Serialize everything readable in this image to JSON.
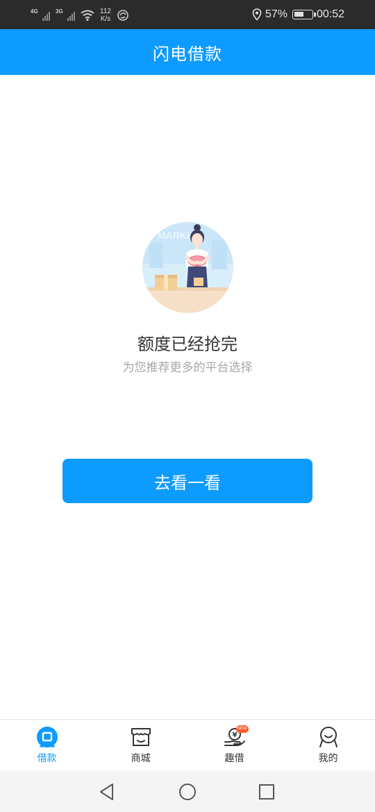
{
  "status_bar": {
    "signal_1_label": "4G",
    "signal_2_label": "3G",
    "net_speed_value": "112",
    "net_speed_unit": "K/s",
    "battery_percent": "57%",
    "battery_level": 0.57,
    "time": "00:52"
  },
  "header": {
    "title": "闪电借款"
  },
  "empty_state": {
    "title": "额度已经抢完",
    "subtitle": "为您推荐更多的平台选择",
    "illustration_text": "MARKET"
  },
  "cta": {
    "label": "去看一看"
  },
  "tab_bar": {
    "items": [
      {
        "label": "借款",
        "icon": "loan-icon",
        "active": true
      },
      {
        "label": "商城",
        "icon": "store-icon",
        "active": false
      },
      {
        "label": "趣借",
        "icon": "hand-coin-icon",
        "active": false,
        "badge": "NEW"
      },
      {
        "label": "我的",
        "icon": "profile-icon",
        "active": false
      }
    ]
  },
  "nav_bar": {
    "buttons": [
      "back-icon",
      "home-icon",
      "recents-icon"
    ]
  },
  "colors": {
    "primary": "#0e9bff",
    "status_bar_bg": "#2b2b2b",
    "badge": "#ff5a2b",
    "title_text": "#333333",
    "subtitle_text": "#a6a6a6"
  }
}
